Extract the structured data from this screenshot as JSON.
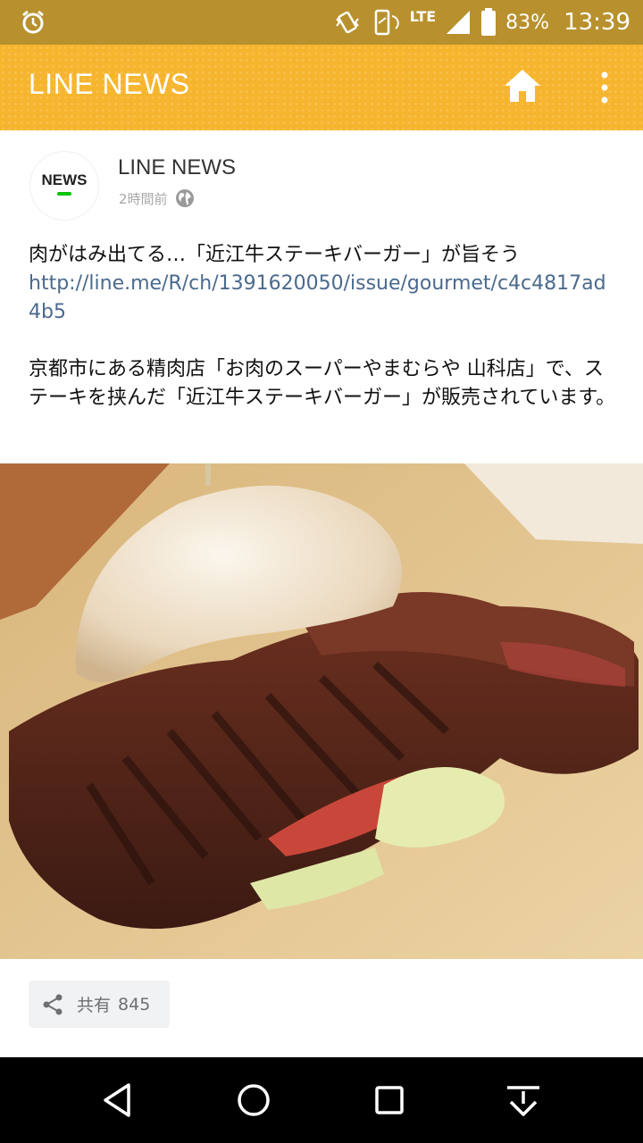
{
  "status_bar": {
    "battery_percent": "83%",
    "time": "13:39",
    "network": "LTE",
    "icons": [
      "alarm-icon",
      "vibrate-icon",
      "rotation-lock-icon",
      "lte-icon",
      "signal-icon",
      "battery-icon"
    ]
  },
  "app_bar": {
    "title": "LINE NEWS",
    "icons": [
      "home-icon",
      "more-vert-icon"
    ]
  },
  "post": {
    "avatar_text": "NEWS",
    "account_name": "LINE NEWS",
    "time": "2時間前",
    "visibility_icon": "globe-icon",
    "headline": "肉がはみ出てる…「近江牛ステーキバーガー」が旨そう",
    "link": "http://line.me/R/ch/1391620050/issue/gourmet/c4c4817ad4b5",
    "body": "京都市にある精肉店「お肉のスーパーやまむらや 山科店」で、ステーキを挟んだ「近江牛ステーキバーガー」が販売されています。",
    "image_icon": "steak-burger-photo"
  },
  "share": {
    "label": "共有",
    "count": "845",
    "icon": "share-icon"
  },
  "nav_bar": {
    "icons": [
      "back-icon",
      "home-circle-icon",
      "recents-icon",
      "notifications-pulldown-icon"
    ]
  },
  "colors": {
    "status_bar": "#b8912e",
    "app_bar": "#f6b52e",
    "link": "#4a6a8d",
    "avatar_accent": "#00c300"
  }
}
